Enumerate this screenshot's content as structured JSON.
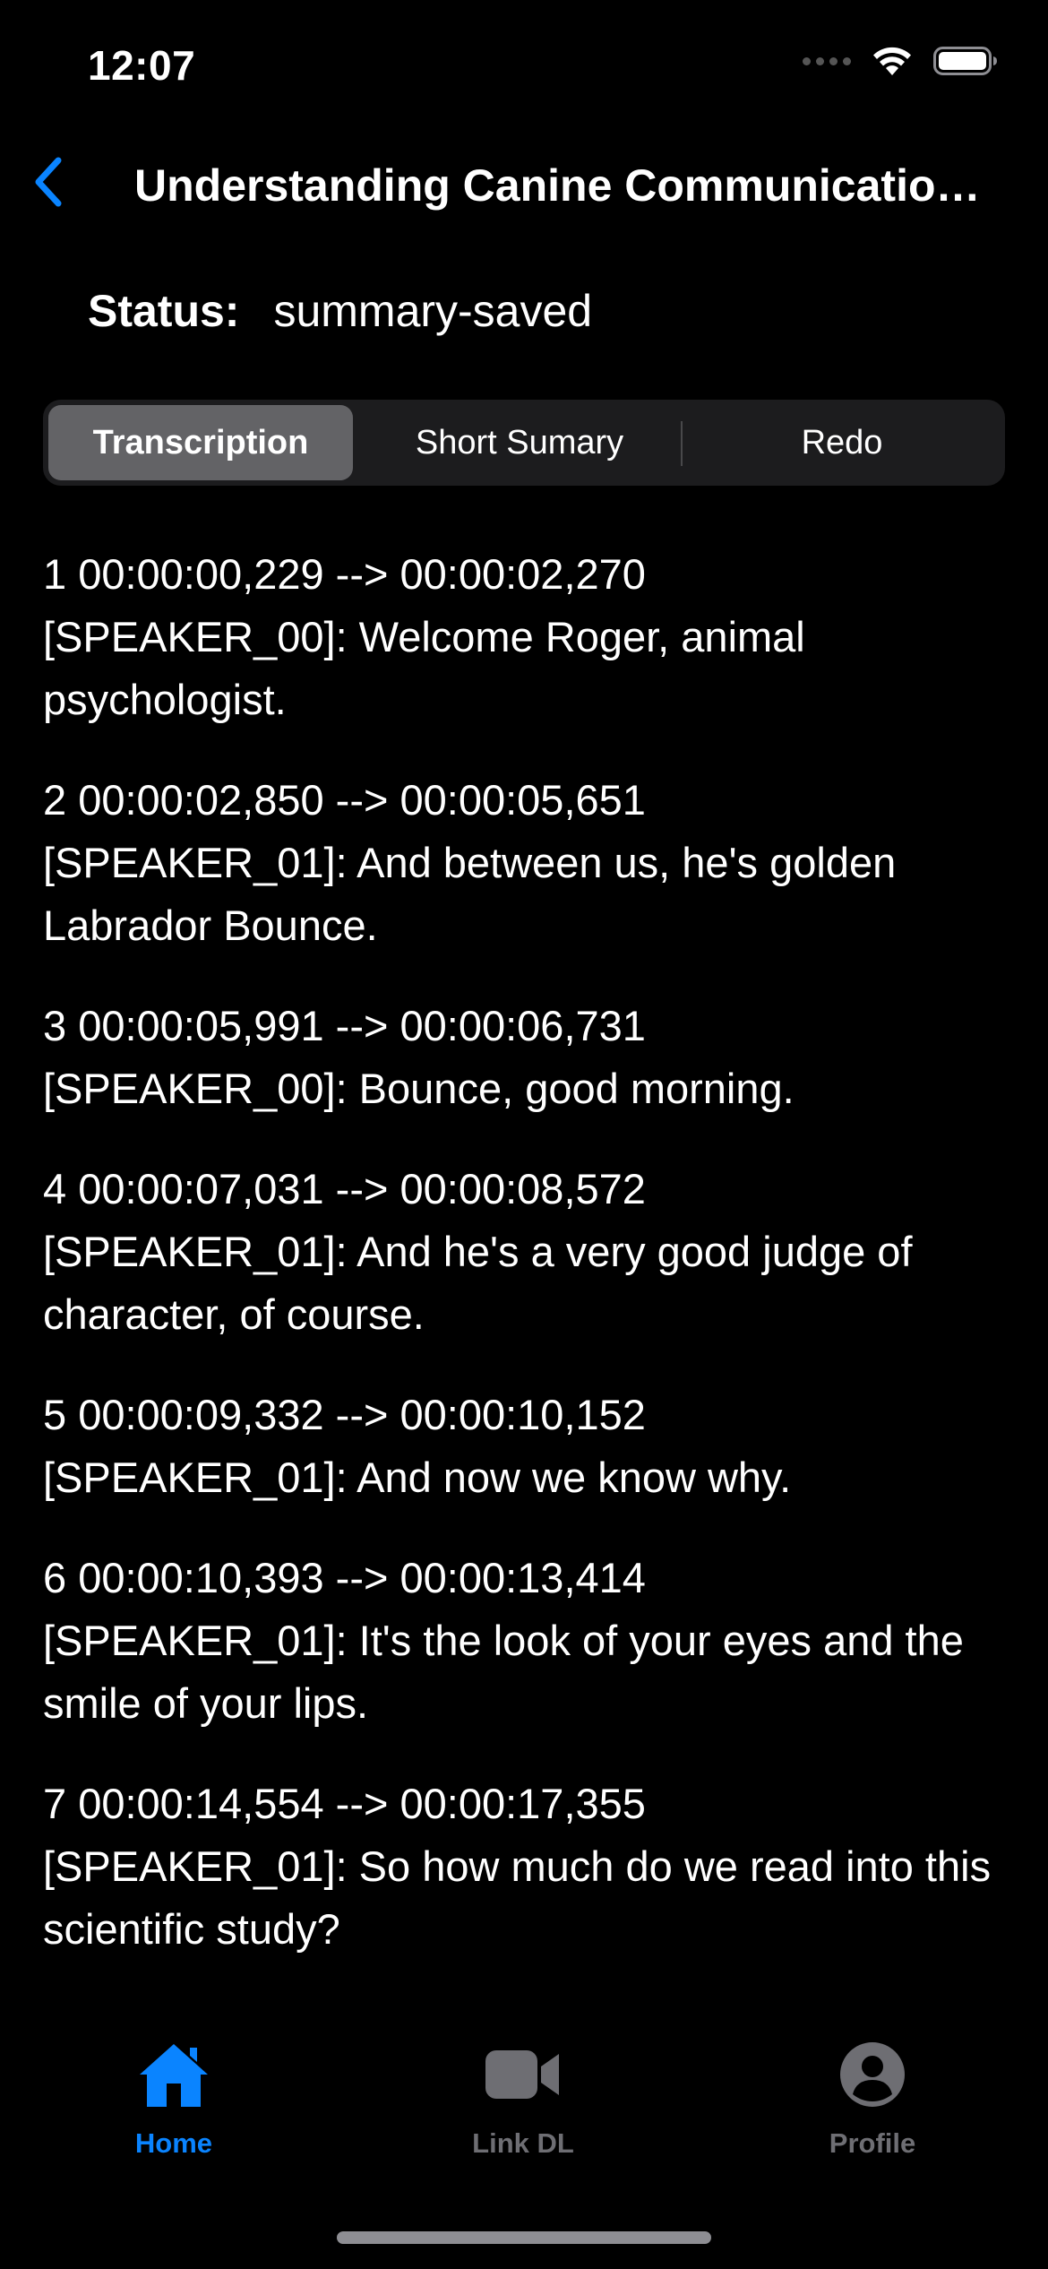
{
  "status_bar": {
    "time": "12:07"
  },
  "nav": {
    "title": "Understanding Canine Communication..."
  },
  "status": {
    "label": "Status:",
    "value": "summary-saved"
  },
  "segments": [
    {
      "label": "Transcription",
      "selected": true
    },
    {
      "label": "Short Sumary",
      "selected": false
    },
    {
      "label": "Redo",
      "selected": false
    }
  ],
  "transcript": [
    {
      "header": "1 00:00:00,229 --> 00:00:02,270",
      "text": "[SPEAKER_00]: Welcome Roger, animal psychologist."
    },
    {
      "header": "2 00:00:02,850 --> 00:00:05,651",
      "text": "[SPEAKER_01]: And between us, he's golden Labrador Bounce."
    },
    {
      "header": "3 00:00:05,991 --> 00:00:06,731",
      "text": "[SPEAKER_00]: Bounce, good morning."
    },
    {
      "header": "4 00:00:07,031 --> 00:00:08,572",
      "text": "[SPEAKER_01]: And he's a very good judge of character, of course."
    },
    {
      "header": "5 00:00:09,332 --> 00:00:10,152",
      "text": "[SPEAKER_01]: And now we know why."
    },
    {
      "header": "6 00:00:10,393 --> 00:00:13,414",
      "text": "[SPEAKER_01]: It's the look of your eyes and the smile of your lips."
    },
    {
      "header": "7 00:00:14,554 --> 00:00:17,355",
      "text": "[SPEAKER_01]: So how much do we read into this scientific study?"
    }
  ],
  "tabs": [
    {
      "label": "Home",
      "icon": "house-icon",
      "active": true
    },
    {
      "label": "Link DL",
      "icon": "video-camera-icon",
      "active": false
    },
    {
      "label": "Profile",
      "icon": "person-circle-icon",
      "active": false
    }
  ],
  "colors": {
    "accent": "#0a84ff",
    "background": "#000000",
    "segment_bg": "#1c1c1e",
    "segment_selected": "#636366",
    "inactive_tab": "#6e6e73"
  }
}
